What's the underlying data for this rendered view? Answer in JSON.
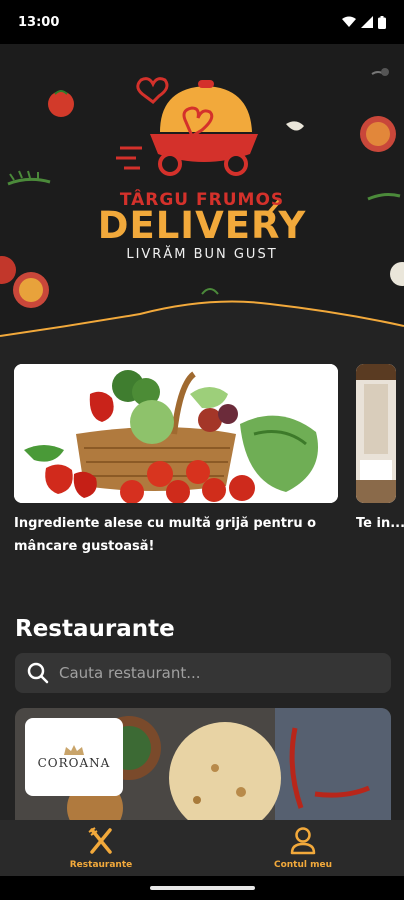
{
  "status": {
    "time": "13:00"
  },
  "brand": {
    "top": "TÂRGU FRUMOS",
    "main": "DELIVERY",
    "tagline": "LIVRĂM BUN GUST"
  },
  "carousel": [
    {
      "caption": "Ingrediente alese cu multă grijă pentru o mâncare gustoasă!"
    },
    {
      "caption": "Te in... vark..."
    }
  ],
  "restaurants": {
    "title": "Restaurante",
    "search_placeholder": "Cauta restaurant...",
    "items": [
      {
        "logo_text": "COROANA"
      }
    ]
  },
  "nav": {
    "items": [
      {
        "label": "Restaurante",
        "icon": "fork-knife-icon"
      },
      {
        "label": "Contul meu",
        "icon": "user-icon"
      }
    ]
  },
  "colors": {
    "accent": "#f2a93b",
    "red": "#d4312b",
    "background": "#232323"
  }
}
